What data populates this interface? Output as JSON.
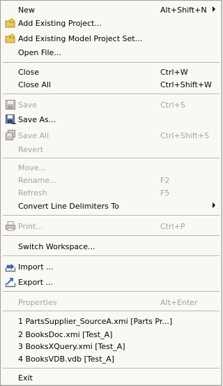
{
  "menu": {
    "new": {
      "label": "New",
      "accel": "Alt+Shift+N"
    },
    "add_existing_project": {
      "label": "Add Existing Project..."
    },
    "add_existing_model_project_set": {
      "label": "Add Existing Model Project Set..."
    },
    "open_file": {
      "label": "Open File..."
    },
    "close": {
      "label": "Close",
      "accel": "Ctrl+W"
    },
    "close_all": {
      "label": "Close All",
      "accel": "Ctrl+Shift+W"
    },
    "save": {
      "label": "Save",
      "accel": "Ctrl+S"
    },
    "save_as": {
      "label": "Save As..."
    },
    "save_all": {
      "label": "Save All",
      "accel": "Ctrl+Shift+S"
    },
    "revert": {
      "label": "Revert"
    },
    "move": {
      "label": "Move..."
    },
    "rename": {
      "label": "Rename...",
      "accel": "F2"
    },
    "refresh": {
      "label": "Refresh",
      "accel": "F5"
    },
    "convert_line_delimiters": {
      "label": "Convert Line Delimiters To"
    },
    "print": {
      "label": "Print...",
      "accel": "Ctrl+P"
    },
    "switch_workspace": {
      "label": "Switch Workspace..."
    },
    "import": {
      "label": "Import ..."
    },
    "export": {
      "label": "Export ..."
    },
    "properties": {
      "label": "Properties",
      "accel": "Alt+Enter"
    },
    "recent_files": [
      {
        "label": "1 PartsSupplier_SourceA.xmi  [Parts Pr...]"
      },
      {
        "label": "2 BooksDoc.xmi  [Test_A]"
      },
      {
        "label": "3 BooksXQuery.xmi  [Test_A]"
      },
      {
        "label": "4 BooksVDB.vdb  [Test_A]"
      }
    ],
    "exit": {
      "label": "Exit"
    }
  },
  "colors": {
    "background": "#f9f8f3",
    "disabled_text": "#a5a39a",
    "separator": "#b4b2aa"
  }
}
